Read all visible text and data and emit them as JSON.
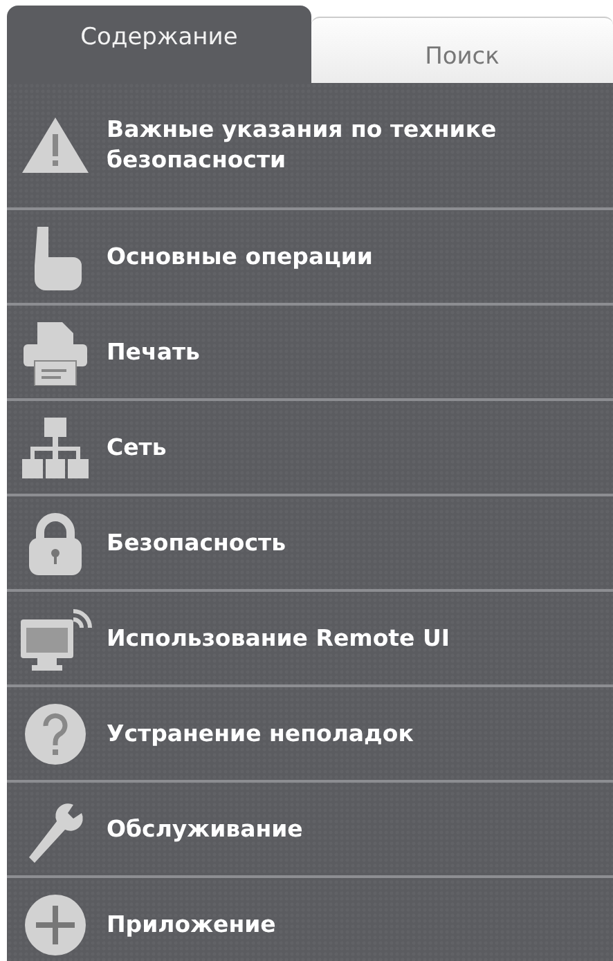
{
  "tabs": [
    {
      "label": "Содержание",
      "selected": true
    },
    {
      "label": "Поиск",
      "selected": false
    }
  ],
  "contents": [
    {
      "kind": "warning",
      "label": "Важные указания по технике безопасности"
    },
    {
      "kind": "hand",
      "label": "Основные операции"
    },
    {
      "kind": "printer",
      "label": "Печать"
    },
    {
      "kind": "network",
      "label": "Сеть"
    },
    {
      "kind": "lock",
      "label": "Безопасность"
    },
    {
      "kind": "monitor",
      "label": "Использование Remote UI"
    },
    {
      "kind": "question",
      "label": "Устранение неполадок"
    },
    {
      "kind": "wrench",
      "label": "Обслуживание"
    },
    {
      "kind": "plus",
      "label": "Приложение"
    }
  ]
}
